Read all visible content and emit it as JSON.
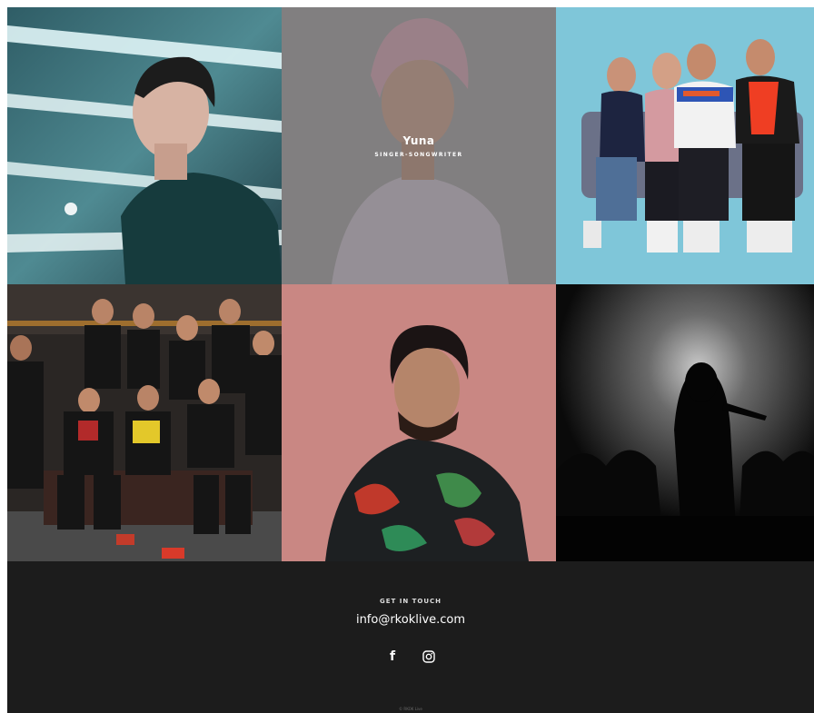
{
  "gallery": {
    "tiles": [
      {
        "id": "tile-1",
        "palette": "teal"
      },
      {
        "id": "tile-2",
        "name": "Yuna",
        "role": "SINGER-SONGWRITER",
        "palette": "grey"
      },
      {
        "id": "tile-3",
        "palette": "skyblue"
      },
      {
        "id": "tile-4",
        "palette": "dark"
      },
      {
        "id": "tile-5",
        "palette": "rose"
      },
      {
        "id": "tile-6",
        "palette": "black"
      }
    ]
  },
  "footer": {
    "heading": "GET IN TOUCH",
    "email": "info@rkoklive.com",
    "social": [
      {
        "icon": "facebook-icon",
        "glyph": "f"
      },
      {
        "icon": "instagram-icon"
      }
    ],
    "copyright": "© RKOK Live"
  },
  "colors": {
    "footer_bg": "#1c1c1c",
    "text": "#ffffff"
  }
}
